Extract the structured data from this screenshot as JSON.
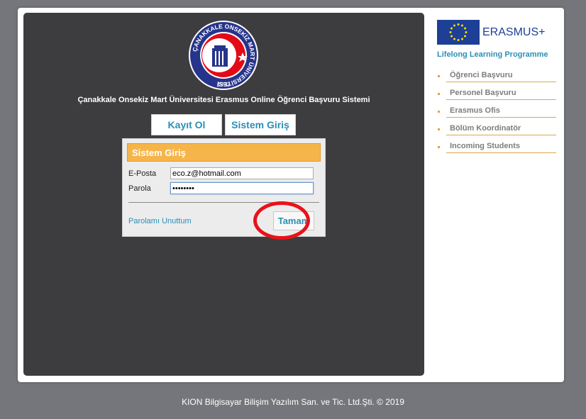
{
  "university": {
    "logo_ring_text": "ÇANAKKALE ONSEKİZ MART ÜNİVERSİTESİ",
    "logo_year": "1992",
    "title": "Çanakkale Onsekiz Mart Üniversitesi Erasmus Online Öğrenci Başvuru Sistemi"
  },
  "tabs": {
    "register_label": "Kayıt Ol",
    "login_label": "Sistem Giriş"
  },
  "login": {
    "header": "Sistem Giriş",
    "email_label": "E-Posta",
    "email_value": "eco.z@hotmail.com",
    "password_label": "Parola",
    "password_value": "********",
    "forgot_label": "Parolamı Unuttum",
    "submit_label": "Tamam"
  },
  "erasmus": {
    "brand": "ERASMUS+",
    "subtitle": "Lifelong Learning Programme",
    "flag_color": "#1d3f95",
    "star_color": "#ffdd00"
  },
  "side_menu": [
    {
      "label": "Öğrenci Başvuru"
    },
    {
      "label": "Personel Başvuru"
    },
    {
      "label": "Erasmus Ofis"
    },
    {
      "label": "Bölüm Koordinatör"
    },
    {
      "label": "Incoming Students"
    }
  ],
  "footer": {
    "text": "KION Bilgisayar Bilişim Yazılım San. ve Tic. Ltd.Şti. © 2019"
  },
  "colors": {
    "accent_link": "#2a8fb5",
    "header_orange": "#f6b54a",
    "highlight_red": "#e8121a",
    "panel_dark": "#3d3d40"
  }
}
